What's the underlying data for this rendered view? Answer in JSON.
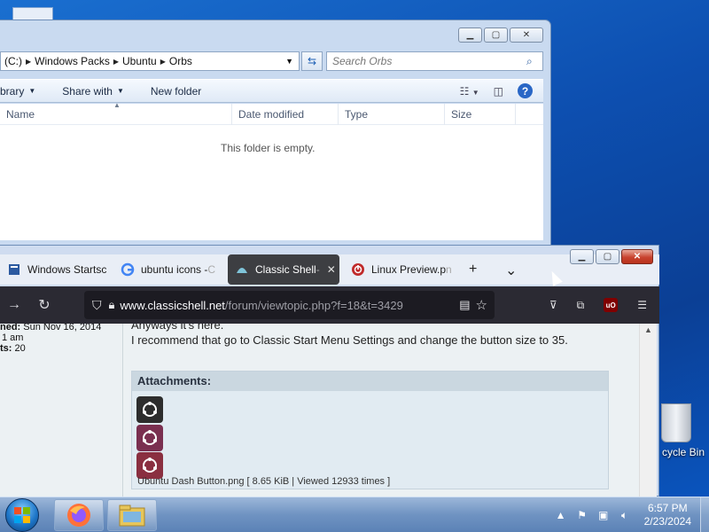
{
  "explorer": {
    "address": {
      "segments": [
        "(C:)",
        "Windows Packs",
        "Ubuntu",
        "Orbs"
      ]
    },
    "search_placeholder": "Search Orbs",
    "cmdbar": {
      "library": "brary",
      "share_with": "Share with",
      "new_folder": "New folder"
    },
    "columns": [
      "Name",
      "Date modified",
      "Type",
      "Size"
    ],
    "empty_message": "This folder is empty."
  },
  "firefox": {
    "tabs": [
      {
        "title": "Windows Startsc",
        "active": false
      },
      {
        "title": "ubuntu icons - ",
        "fade": "C",
        "active": false
      },
      {
        "title": "Classic Shell",
        "fade": " -",
        "active": true
      },
      {
        "title": "Linux Preview.p",
        "fade": "n",
        "active": false
      }
    ],
    "url_host": "www.classicshell.net",
    "url_path": "/forum/viewtopic.php?f=18&t=3429",
    "profile": {
      "joined_label": "ned:",
      "joined_value": "Sun Nov 16, 2014",
      "time": "1 am",
      "posts_label": "ts:",
      "posts_value": "20"
    },
    "post": {
      "line1": "Anyways it's here.",
      "line2": "I recommend that go to Classic Start Menu Settings and change the button size to 35.",
      "attachments_title": "Attachments:",
      "attachment_caption": "Ubuntu Dash Button.png [ 8.65 KiB | Viewed 12933 times ]"
    }
  },
  "taskbar": {
    "time": "6:57 PM",
    "date": "2/23/2024"
  },
  "desktop": {
    "recycle_bin": "cycle Bin"
  }
}
